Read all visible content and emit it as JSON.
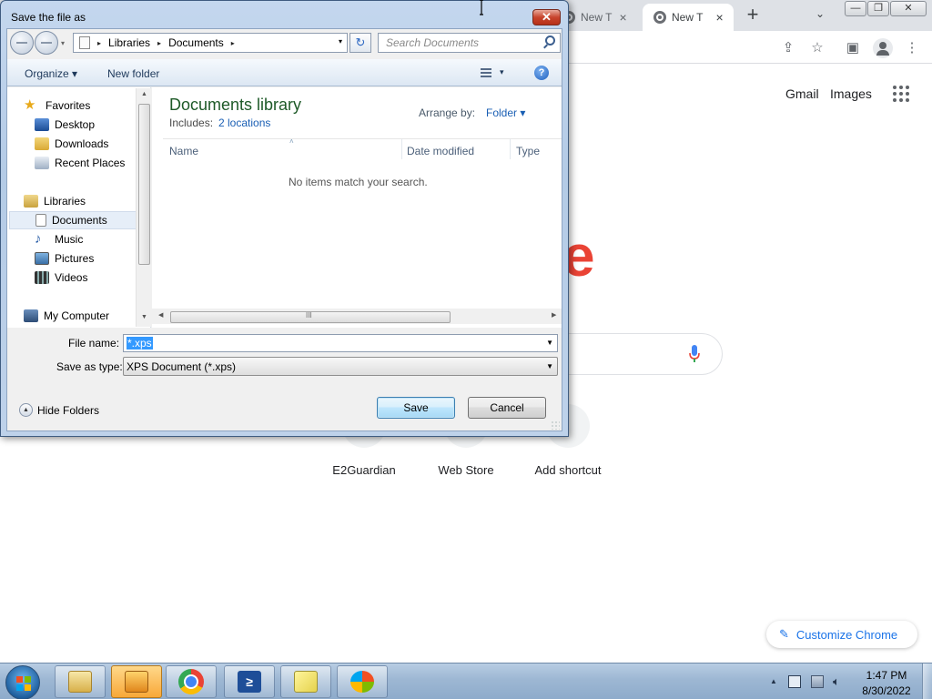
{
  "chrome": {
    "tabs": [
      {
        "label": "New T",
        "close": "×"
      },
      {
        "label": "New T",
        "close": "×"
      }
    ],
    "new_tab": "+",
    "tab_search": "⌄",
    "window_buttons": {
      "minimize": "—",
      "maximize": "❐",
      "close": "✕"
    },
    "toolbar_icons": {
      "share": "⇪",
      "bookmark": "☆",
      "side_panel": "▣",
      "menu": "⋮"
    },
    "header_links": {
      "gmail": "Gmail",
      "images": "Images"
    },
    "logo_fragment": "e",
    "shortcuts": [
      "E2Guardian",
      "Web Store",
      "Add shortcut"
    ],
    "customize_label": "Customize Chrome",
    "customize_icon": "✎",
    "accent_color": "#1a73e8"
  },
  "dialog": {
    "title": "Save the file as",
    "close": "✕",
    "address": {
      "crumbs": [
        "Libraries",
        "Documents"
      ],
      "separator": "▸",
      "dropdown": "▾"
    },
    "refresh": "↻",
    "search_placeholder": "Search Documents",
    "toolbar": {
      "organize": "Organize ▾",
      "new_folder": "New folder",
      "views_dropdown": "▾",
      "help": "?"
    },
    "nav": {
      "favorites_header": "Favorites",
      "favorites": [
        "Desktop",
        "Downloads",
        "Recent Places"
      ],
      "libraries_header": "Libraries",
      "libraries": [
        "Documents",
        "Music",
        "Pictures",
        "Videos"
      ],
      "computer": "My Computer",
      "selected": "Documents"
    },
    "library": {
      "title": "Documents library",
      "includes_label": "Includes:",
      "locations": "2 locations",
      "arrange_label": "Arrange by:",
      "arrange_value": "Folder ▾"
    },
    "columns": [
      "Name",
      "Date modified",
      "Type"
    ],
    "sort_caret": "˄",
    "empty_message": "No items match your search.",
    "scroll": {
      "up": "▲",
      "down": "▼",
      "left": "◀",
      "right": "▶",
      "grip": "III"
    },
    "file_name_label": "File name:",
    "file_name_value": "*.xps",
    "save_type_label": "Save as type:",
    "save_type_value": "XPS Document (*.xps)",
    "dropdown_arrow": "▼",
    "hide_folders": "Hide Folders",
    "hide_folders_icon": "▲",
    "save_button": "Save",
    "cancel_button": "Cancel"
  },
  "taskbar": {
    "tray_expand": "▲",
    "time": "1:47 PM",
    "date": "8/30/2022",
    "ps_glyph": "≥"
  }
}
